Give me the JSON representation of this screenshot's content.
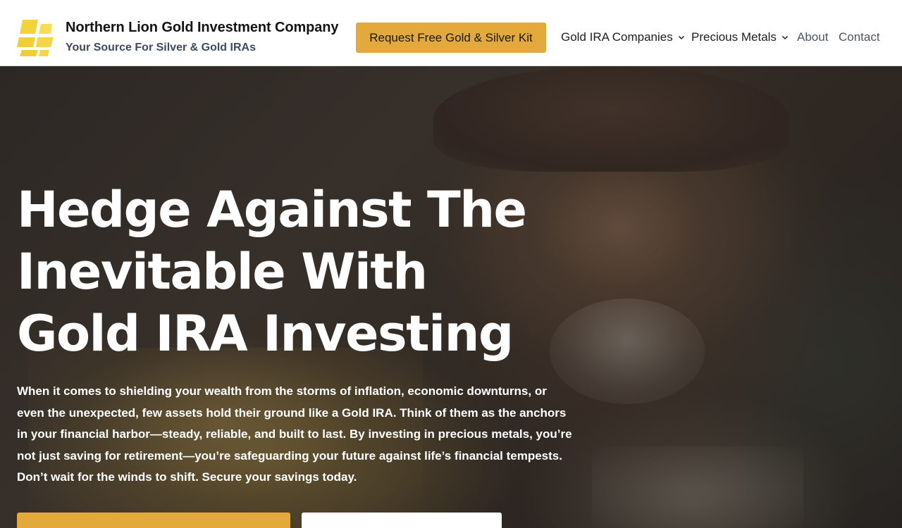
{
  "header": {
    "brand_title": "Northern Lion Gold Investment Company",
    "brand_tagline": "Your Source For Silver & Gold IRAs",
    "logo_icon": "gold-bars-logo-icon",
    "cta_label": "Request Free Gold & Silver Kit"
  },
  "nav": {
    "items": [
      {
        "label": "Gold IRA Companies",
        "has_dropdown": true
      },
      {
        "label": "Precious Metals",
        "has_dropdown": true
      },
      {
        "label": "About",
        "has_dropdown": false
      },
      {
        "label": "Contact",
        "has_dropdown": false
      }
    ],
    "dropdown_icon": "chevron-down-icon"
  },
  "hero": {
    "title": "Hedge Against The Inevitable With Gold IRA Investing",
    "body": "When it comes to shielding your wealth from the storms of inflation, economic downturns, or even the unexpected, few assets hold their ground like a Gold IRA. Think of them as the anchors in your financial harbor—steady, reliable, and built to last. By investing in precious metals, you’re not just saving for retirement—you’re safeguarding your future against life’s financial tempests. Don’t wait for the winds to shift. Secure your savings today."
  },
  "colors": {
    "accent": "#e3a93a",
    "logo_yellow": "#f4d23a",
    "tagline": "#3f4a5a",
    "nav_text": "#1e1e1e",
    "nav_text_light": "#4a5563"
  }
}
